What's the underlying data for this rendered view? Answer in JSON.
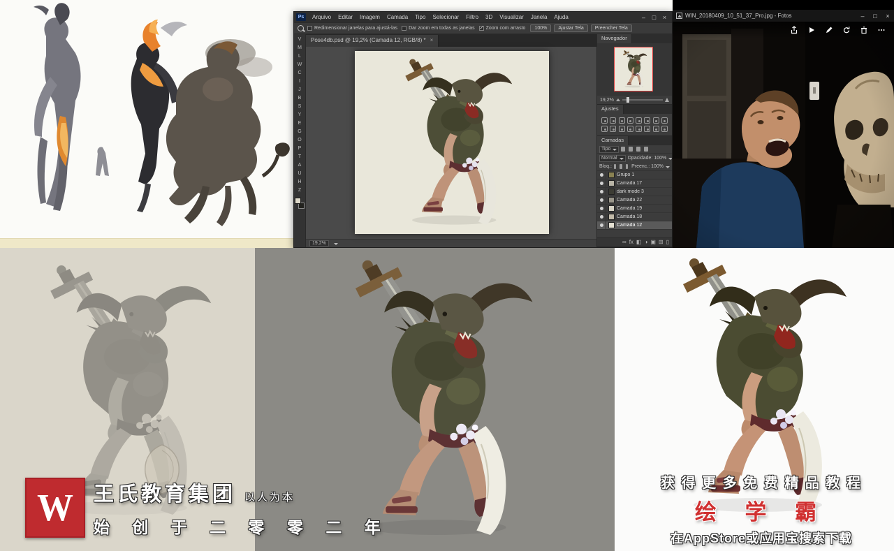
{
  "photoshop": {
    "app_icon": "Ps",
    "menu_items": [
      "Arquivo",
      "Editar",
      "Imagem",
      "Camada",
      "Tipo",
      "Selecionar",
      "Filtro",
      "3D",
      "Visualizar",
      "Janela",
      "Ajuda"
    ],
    "window_controls": {
      "minimize": "–",
      "maximize": "□",
      "close": "×"
    },
    "options_bar": {
      "checkboxes": [
        {
          "label": "Redimensionar janelas para ajustá-las",
          "checked": false
        },
        {
          "label": "Dar zoom em todas as janelas",
          "checked": false
        },
        {
          "label": "Zoom com arrasto",
          "checked": true
        }
      ],
      "buttons": [
        "100%",
        "Ajustar Tela",
        "Preencher Tela"
      ]
    },
    "document_tab": "Pose4db.psd @ 19,2% (Camada 12, RGB/8) *",
    "tab_close": "×",
    "status_zoom": "19,2%",
    "tools": [
      {
        "key": "V",
        "name": "move-tool"
      },
      {
        "key": "M",
        "name": "marquee-tool"
      },
      {
        "key": "L",
        "name": "lasso-tool"
      },
      {
        "key": "W",
        "name": "quick-selection-tool"
      },
      {
        "key": "C",
        "name": "crop-tool"
      },
      {
        "key": "I",
        "name": "eyedropper-tool"
      },
      {
        "key": "J",
        "name": "healing-brush-tool"
      },
      {
        "key": "B",
        "name": "brush-tool"
      },
      {
        "key": "S",
        "name": "clone-stamp-tool"
      },
      {
        "key": "Y",
        "name": "history-brush-tool"
      },
      {
        "key": "E",
        "name": "eraser-tool"
      },
      {
        "key": "G",
        "name": "gradient-tool"
      },
      {
        "key": "O",
        "name": "dodge-tool"
      },
      {
        "key": "P",
        "name": "pen-tool"
      },
      {
        "key": "T",
        "name": "type-tool"
      },
      {
        "key": "A",
        "name": "path-selection-tool"
      },
      {
        "key": "U",
        "name": "shape-tool"
      },
      {
        "key": "H",
        "name": "hand-tool"
      },
      {
        "key": "Z",
        "name": "zoom-tool"
      }
    ],
    "navigator": {
      "title": "Navegador",
      "zoom": "19,2%"
    },
    "adjustments": {
      "title": "Ajustes",
      "icons": [
        {
          "name": "brightness-contrast-icon"
        },
        {
          "name": "levels-icon"
        },
        {
          "name": "curves-icon"
        },
        {
          "name": "exposure-icon"
        },
        {
          "name": "vibrance-icon"
        },
        {
          "name": "hue-saturation-icon"
        },
        {
          "name": "color-balance-icon"
        },
        {
          "name": "black-and-white-icon"
        },
        {
          "name": "photo-filter-icon"
        },
        {
          "name": "channel-mixer-icon"
        },
        {
          "name": "color-lookup-icon"
        },
        {
          "name": "invert-icon"
        },
        {
          "name": "posterize-icon"
        },
        {
          "name": "threshold-icon"
        },
        {
          "name": "selective-color-icon"
        },
        {
          "name": "gradient-map-icon"
        }
      ]
    },
    "layers": {
      "tab": "Camadas",
      "filter_label": "Tipo",
      "blend_mode": "Normal",
      "opacity_label": "Opacidade:",
      "opacity_value": "100%",
      "lock_label": "Bloq.:",
      "fill_label": "Preenc.:",
      "fill_value": "100%",
      "rows": [
        {
          "name": "Grupo 1",
          "is_group": true,
          "visible": true,
          "selected": false,
          "thumb": "#8a8252"
        },
        {
          "name": "Camada 17",
          "is_group": false,
          "visible": true,
          "selected": false,
          "thumb": "#b8b4a6"
        },
        {
          "name": "dark mode 3",
          "is_group": false,
          "visible": true,
          "selected": false,
          "thumb": "#3c3c34"
        },
        {
          "name": "Camada 22",
          "is_group": false,
          "visible": true,
          "selected": false,
          "thumb": "#9a968a"
        },
        {
          "name": "Camada 19",
          "is_group": false,
          "visible": true,
          "selected": false,
          "thumb": "#d6d2c4"
        },
        {
          "name": "Camada 18",
          "is_group": false,
          "visible": true,
          "selected": false,
          "thumb": "#c2baa8"
        },
        {
          "name": "Camada 12",
          "is_group": false,
          "visible": true,
          "selected": true,
          "thumb": "#e4e0d2"
        }
      ],
      "footer_icons": [
        {
          "glyph": "∞",
          "name": "link-layers-icon"
        },
        {
          "glyph": "fx",
          "name": "layer-style-icon"
        },
        {
          "glyph": "◧",
          "name": "layer-mask-icon"
        },
        {
          "glyph": "◑",
          "name": "adjustment-layer-icon"
        },
        {
          "glyph": "▣",
          "name": "new-group-icon"
        },
        {
          "glyph": "⊞",
          "name": "new-layer-icon"
        },
        {
          "glyph": "▯",
          "name": "delete-layer-icon"
        }
      ]
    }
  },
  "photos": {
    "title": "WIN_20180409_10_51_37_Pro.jpg - Fotos",
    "window_controls": {
      "minimize": "–",
      "maximize": "□",
      "close": "×"
    },
    "toolbar_icons": [
      "share-icon",
      "slideshow-icon",
      "edit-icon",
      "rotate-icon",
      "delete-icon",
      "see-more-icon"
    ]
  },
  "watermark": {
    "logo_letter": "W",
    "brand": "王氏教育集团",
    "tagline": "以人为本",
    "founded": "始 创 于 二 零 零 二 年"
  },
  "promo": {
    "line1": "获 得 更 多 免 费 精 品 教 程",
    "brand": "绘 学 霸",
    "line2": "在AppStore或应用宝搜索下载"
  }
}
